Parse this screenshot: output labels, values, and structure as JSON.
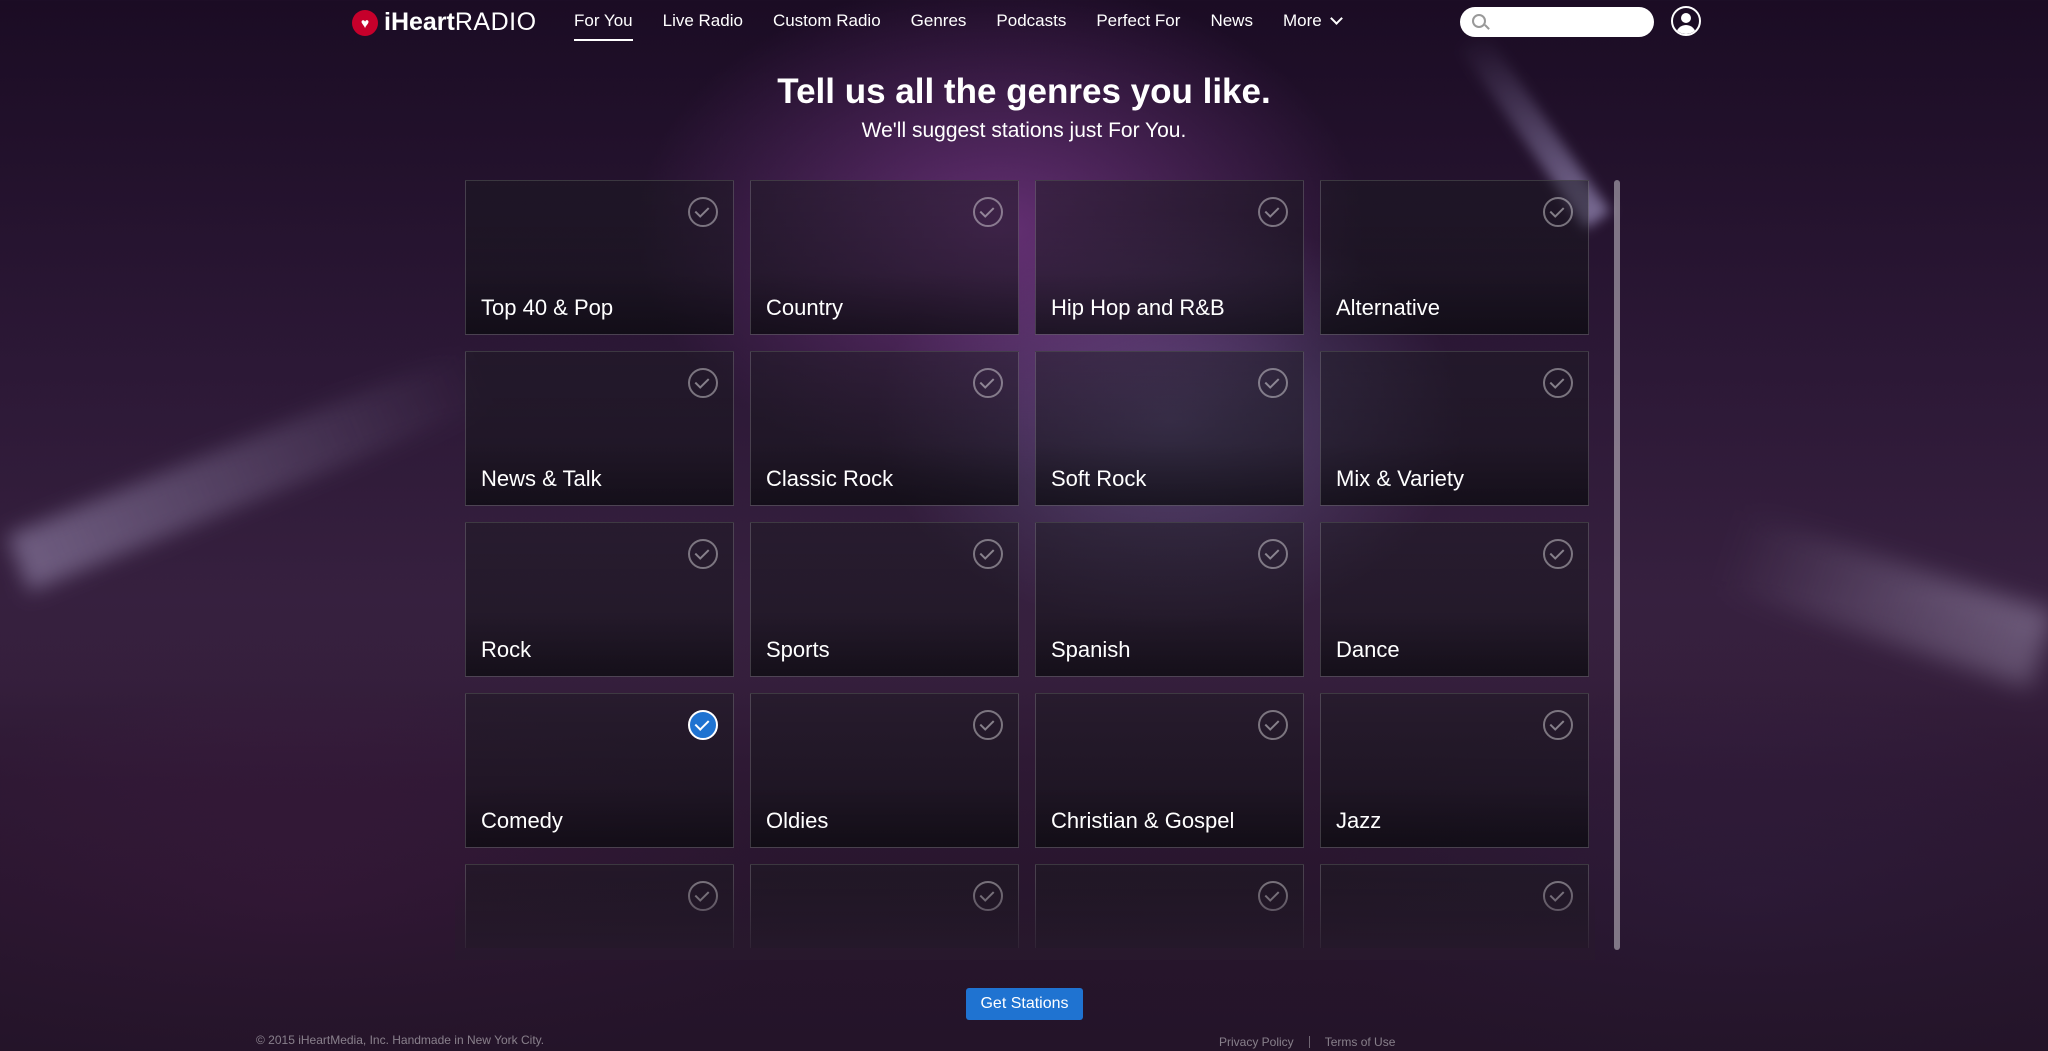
{
  "brand": {
    "logo_bold": "iHeart",
    "logo_light": "RADIO"
  },
  "nav": {
    "items": [
      {
        "label": "For You",
        "active": true
      },
      {
        "label": "Live Radio",
        "active": false
      },
      {
        "label": "Custom Radio",
        "active": false
      },
      {
        "label": "Genres",
        "active": false
      },
      {
        "label": "Podcasts",
        "active": false
      },
      {
        "label": "Perfect For",
        "active": false
      },
      {
        "label": "News",
        "active": false
      },
      {
        "label": "More",
        "active": false
      }
    ],
    "search_value": ""
  },
  "heading": {
    "title": "Tell us all the genres you like.",
    "subtitle": "We'll suggest stations just For You."
  },
  "genres": [
    {
      "label": "Top 40 & Pop",
      "selected": false
    },
    {
      "label": "Country",
      "selected": false
    },
    {
      "label": "Hip Hop and R&B",
      "selected": false
    },
    {
      "label": "Alternative",
      "selected": false
    },
    {
      "label": "News & Talk",
      "selected": false
    },
    {
      "label": "Classic Rock",
      "selected": false
    },
    {
      "label": "Soft Rock",
      "selected": false
    },
    {
      "label": "Mix & Variety",
      "selected": false
    },
    {
      "label": "Rock",
      "selected": false
    },
    {
      "label": "Sports",
      "selected": false
    },
    {
      "label": "Spanish",
      "selected": false
    },
    {
      "label": "Dance",
      "selected": false
    },
    {
      "label": "Comedy",
      "selected": true
    },
    {
      "label": "Oldies",
      "selected": false
    },
    {
      "label": "Christian & Gospel",
      "selected": false
    },
    {
      "label": "Jazz",
      "selected": false
    },
    {
      "label": "",
      "selected": false
    },
    {
      "label": "",
      "selected": false
    },
    {
      "label": "",
      "selected": false
    },
    {
      "label": "",
      "selected": false
    }
  ],
  "cta": {
    "label": "Get Stations"
  },
  "footer": {
    "copyright": "© 2015 iHeartMedia, Inc. Handmade in New York City.",
    "privacy": "Privacy Policy",
    "terms": "Terms of Use"
  },
  "colors": {
    "accent": "#1f73d1",
    "brand": "#c6002b"
  }
}
